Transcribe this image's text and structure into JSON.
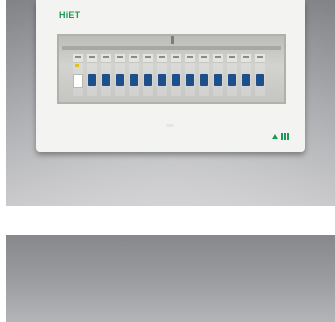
{
  "product_photo": {
    "brand": "HiET",
    "breaker_count": 14
  },
  "second_photo": {}
}
